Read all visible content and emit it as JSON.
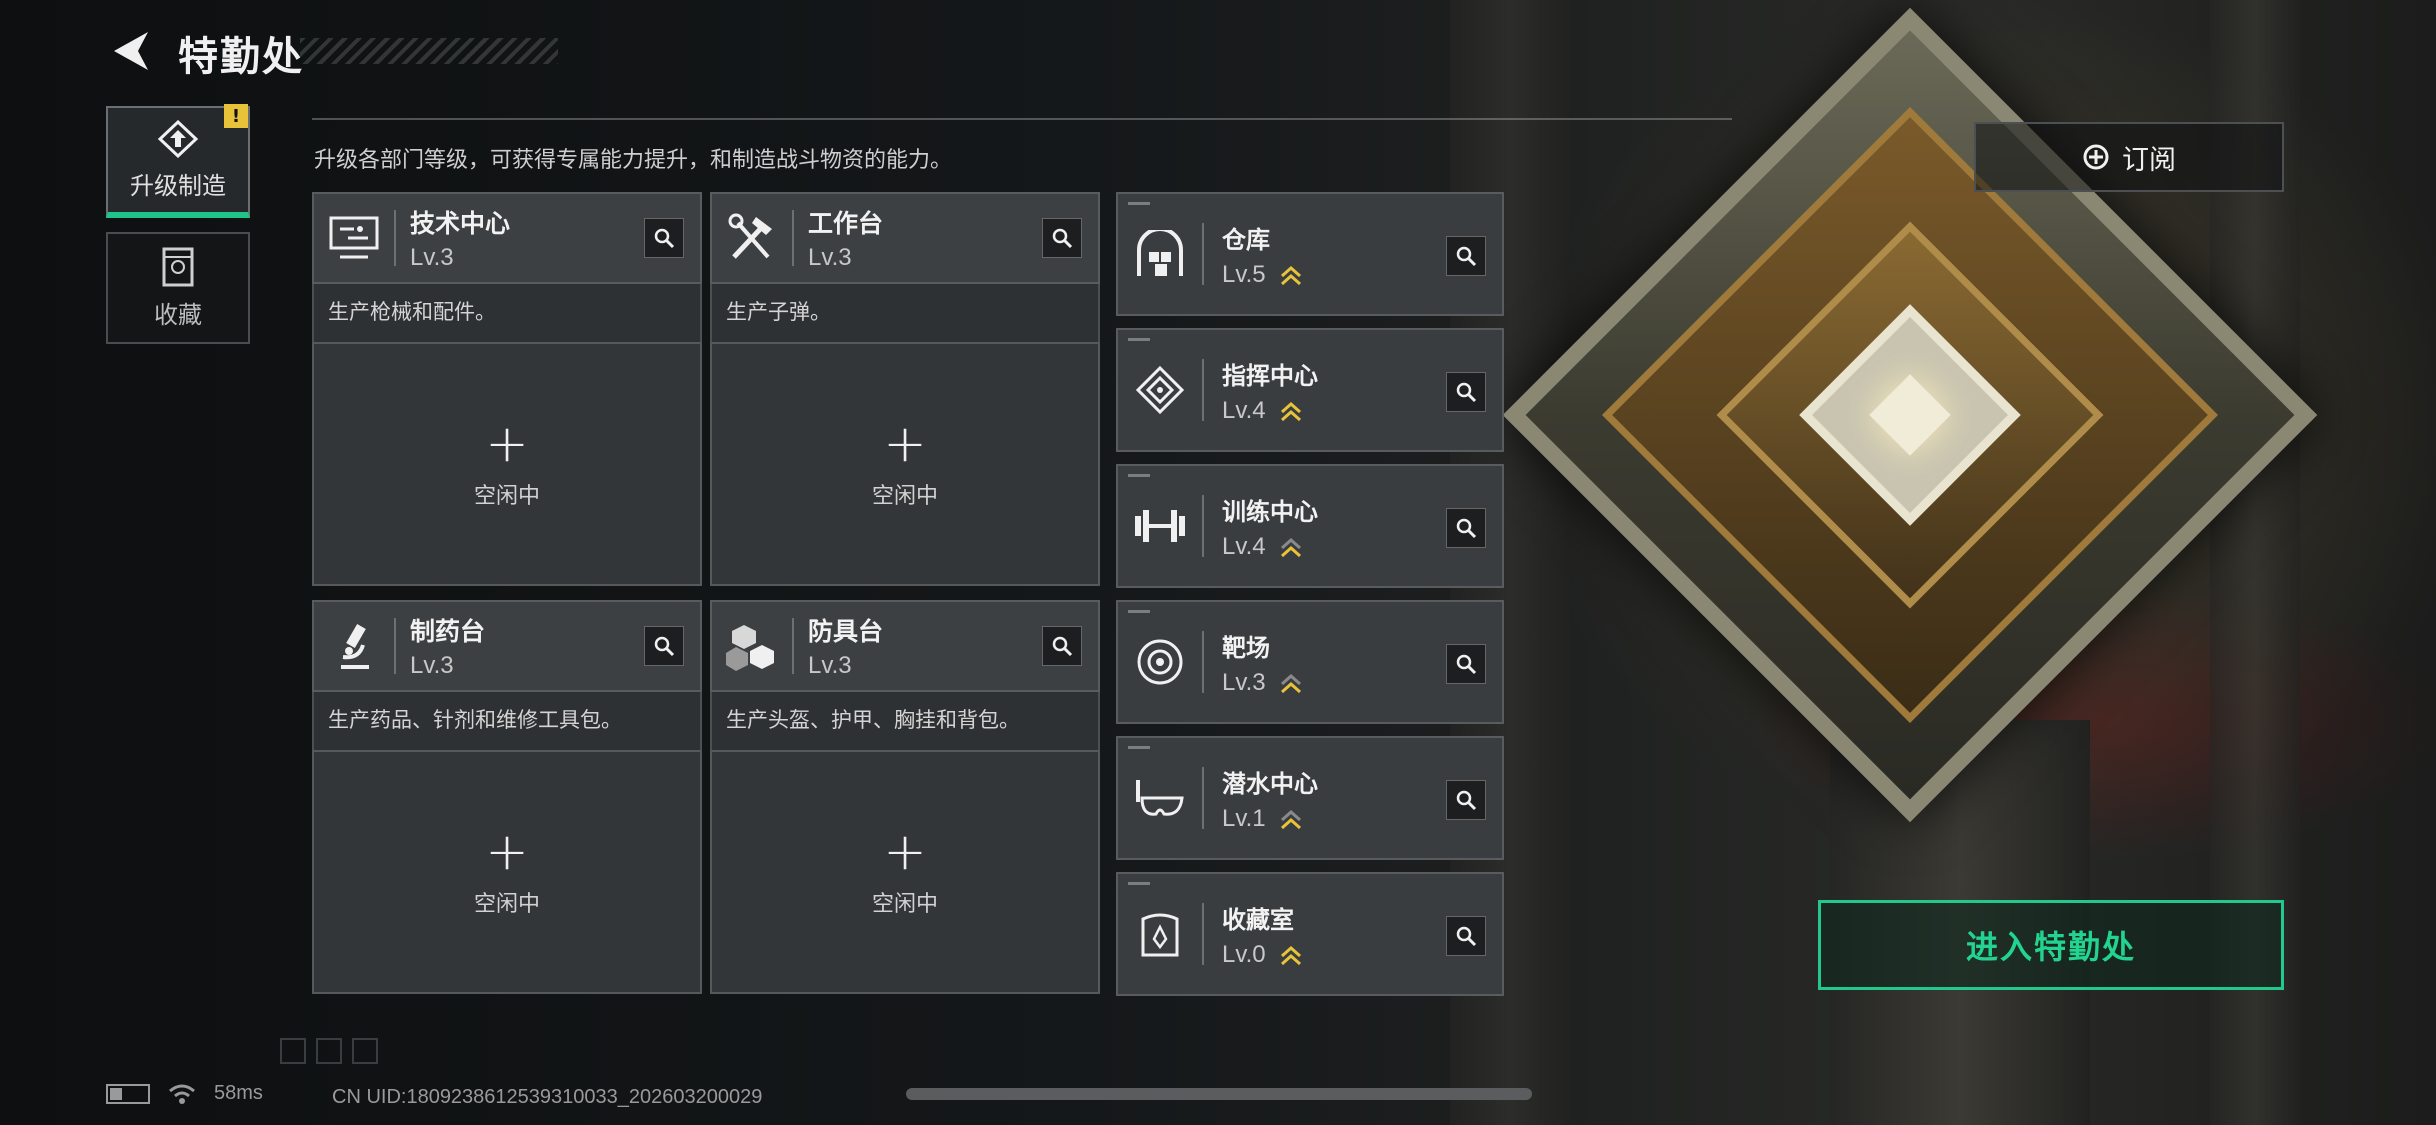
{
  "header": {
    "title": "特勤处",
    "subtitle": "升级各部门等级，可获得专属能力提升，和制造战斗物资的能力。"
  },
  "side_tabs": [
    {
      "label": "升级制造",
      "icon": "upgrade-icon",
      "active": true,
      "badge": "!"
    },
    {
      "label": "收藏",
      "icon": "collection-icon",
      "active": false
    }
  ],
  "production_cards": [
    {
      "name": "技术中心",
      "level": "Lv.3",
      "icon": "computer-icon",
      "desc": "生产枪械和配件。",
      "slot_status": "空闲中"
    },
    {
      "name": "工作台",
      "level": "Lv.3",
      "icon": "tools-icon",
      "desc": "生产子弹。",
      "slot_status": "空闲中"
    },
    {
      "name": "制药台",
      "level": "Lv.3",
      "icon": "microscope-icon",
      "desc": "生产药品、针剂和维修工具包。",
      "slot_status": "空闲中"
    },
    {
      "name": "防具台",
      "level": "Lv.3",
      "icon": "armor-blocks-icon",
      "desc": "生产头盔、护甲、胸挂和背包。",
      "slot_status": "空闲中"
    }
  ],
  "departments": [
    {
      "name": "仓库",
      "level": "Lv.5",
      "icon": "warehouse-icon"
    },
    {
      "name": "指挥中心",
      "level": "Lv.4",
      "icon": "command-chip-icon"
    },
    {
      "name": "训练中心",
      "level": "Lv.4",
      "icon": "dumbbell-icon"
    },
    {
      "name": "靶场",
      "level": "Lv.3",
      "icon": "target-icon"
    },
    {
      "name": "潜水中心",
      "level": "Lv.1",
      "icon": "diving-mask-icon"
    },
    {
      "name": "收藏室",
      "level": "Lv.0",
      "icon": "display-case-icon"
    }
  ],
  "buttons": {
    "subscribe": "订阅",
    "enter": "进入特勤处"
  },
  "footer": {
    "ping": "58ms",
    "uid": "CN UID:1809238612539310033_202603200029"
  },
  "colors": {
    "accent_green": "#21c98c",
    "upgrade_arrow": "#e8c33a",
    "warning_badge": "#e8c33a"
  }
}
